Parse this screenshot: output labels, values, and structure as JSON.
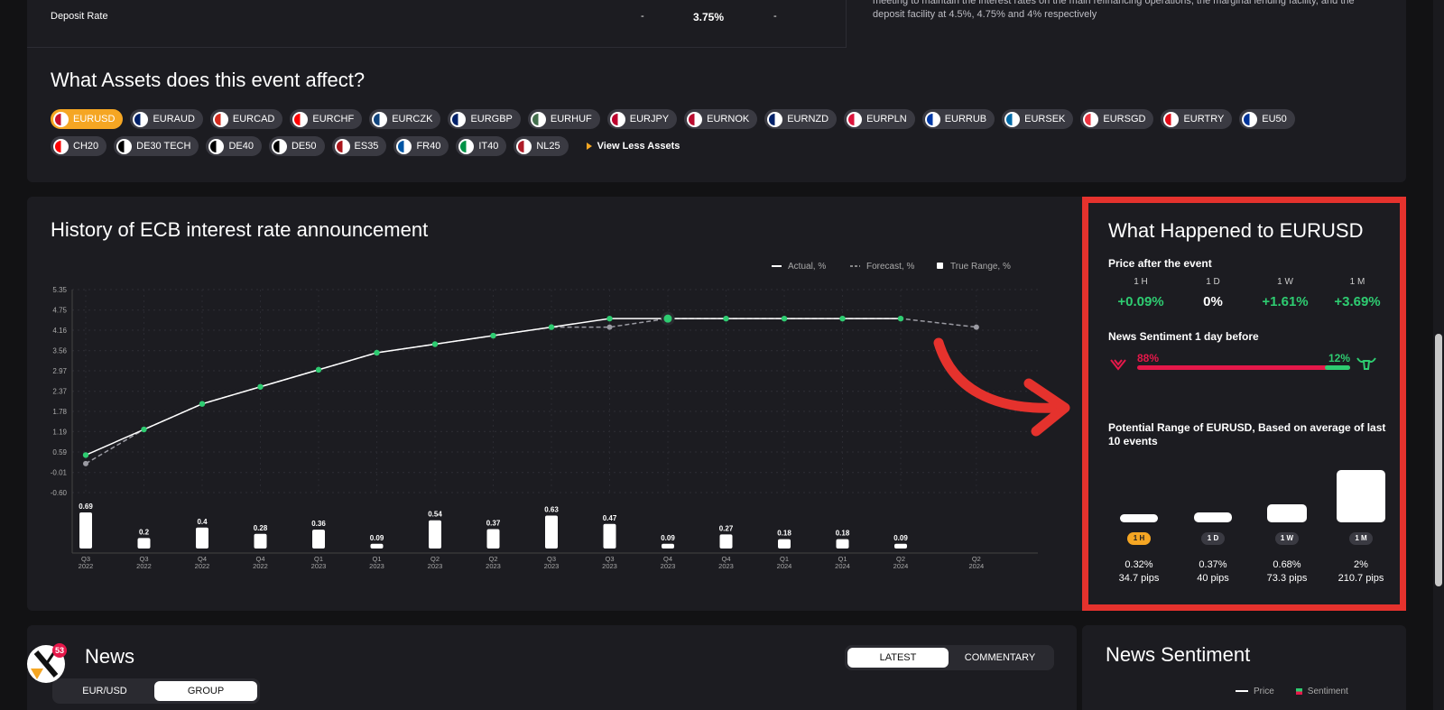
{
  "rate_row": {
    "label": "Deposit Rate",
    "previous": "-",
    "actual": "3.75%",
    "forecast": "-"
  },
  "description": "meeting to maintain the interest rates on the main refinancing operations, the marginal lending facility, and the deposit facility at 4.5%, 4.75% and 4% respectively",
  "assets": {
    "title": "What Assets does this event affect?",
    "chips": [
      "EURUSD",
      "EURAUD",
      "EURCAD",
      "EURCHF",
      "EURCZK",
      "EURGBP",
      "EURHUF",
      "EURJPY",
      "EURNOK",
      "EURNZD",
      "EURPLN",
      "EURRUB",
      "EURSEK",
      "EURSGD",
      "EURTRY",
      "EU50",
      "CH20",
      "DE30 TECH",
      "DE40",
      "DE50",
      "ES35",
      "FR40",
      "IT40",
      "NL25"
    ],
    "active": "EURUSD",
    "view_less": "View Less Assets"
  },
  "history": {
    "title": "History of ECB interest rate announcement",
    "legend": {
      "actual": "Actual, %",
      "forecast": "Forecast, %",
      "range": "True Range, %"
    }
  },
  "chart_data": {
    "type": "line",
    "y_ticks": [
      "5.35",
      "4.75",
      "4.16",
      "3.56",
      "2.97",
      "2.37",
      "1.78",
      "1.19",
      "0.59",
      "-0.01",
      "-0.60"
    ],
    "x": [
      [
        "Q3",
        "2022"
      ],
      [
        "Q3",
        "2022"
      ],
      [
        "Q4",
        "2022"
      ],
      [
        "Q4",
        "2022"
      ],
      [
        "Q1",
        "2023"
      ],
      [
        "Q1",
        "2023"
      ],
      [
        "Q2",
        "2023"
      ],
      [
        "Q2",
        "2023"
      ],
      [
        "Q3",
        "2023"
      ],
      [
        "Q3",
        "2023"
      ],
      [
        "Q4",
        "2023"
      ],
      [
        "Q4",
        "2023"
      ],
      [
        "Q1",
        "2024"
      ],
      [
        "Q1",
        "2024"
      ],
      [
        "Q2",
        "2024"
      ],
      [
        "Q2",
        "2024"
      ]
    ],
    "x_pos": [
      0,
      1,
      2,
      3,
      4,
      5,
      6,
      7,
      8,
      9,
      10,
      11,
      12,
      13,
      14,
      15.3
    ],
    "series": [
      {
        "name": "Actual, %",
        "values": [
          0.5,
          1.25,
          2.0,
          2.5,
          3.0,
          3.5,
          3.75,
          4.0,
          4.25,
          4.5,
          4.5,
          4.5,
          4.5,
          4.5,
          4.5,
          null
        ]
      },
      {
        "name": "Forecast, %",
        "values": [
          0.25,
          1.25,
          2.0,
          2.5,
          3.0,
          3.5,
          3.75,
          4.0,
          4.25,
          4.25,
          4.5,
          4.5,
          4.5,
          4.5,
          4.5,
          4.25
        ]
      }
    ],
    "true_range": [
      0.69,
      0.2,
      0.4,
      0.28,
      0.36,
      0.09,
      0.54,
      0.37,
      0.63,
      0.47,
      0.09,
      0.27,
      0.18,
      0.18,
      0.09
    ],
    "ylim": [
      -0.6,
      5.35
    ]
  },
  "what_happened": {
    "title": "What Happened to EURUSD",
    "price_title": "Price after the event",
    "prices": [
      {
        "period": "1 H",
        "value": "+0.09%",
        "color": "#2ecc71"
      },
      {
        "period": "1 D",
        "value": "0%",
        "color": "#ffffff"
      },
      {
        "period": "1 W",
        "value": "+1.61%",
        "color": "#2ecc71"
      },
      {
        "period": "1 M",
        "value": "+3.69%",
        "color": "#2ecc71"
      }
    ],
    "sentiment_title": "News Sentiment 1 day before",
    "bearish": "88%",
    "bullish": "12%",
    "bullish_fraction": 0.12,
    "range_title": "Potential Range of EURUSD, Based on average of last 10 events",
    "ranges": [
      {
        "period": "1 H",
        "pct": "0.32%",
        "pips": "34.7 pips",
        "value": 0.32
      },
      {
        "period": "1 D",
        "pct": "0.37%",
        "pips": "40 pips",
        "value": 0.37
      },
      {
        "period": "1 W",
        "pct": "0.68%",
        "pips": "73.3 pips",
        "value": 0.68
      },
      {
        "period": "1 M",
        "pct": "2%",
        "pips": "210.7 pips",
        "value": 2
      }
    ]
  },
  "news": {
    "title": "News",
    "tabs": [
      "LATEST",
      "COMMENTARY"
    ],
    "filters": [
      "EUR/USD",
      "GROUP"
    ],
    "badge": "53"
  },
  "news_sentiment": {
    "title": "News Sentiment",
    "legend_price": "Price",
    "legend_sentiment": "Sentiment"
  }
}
